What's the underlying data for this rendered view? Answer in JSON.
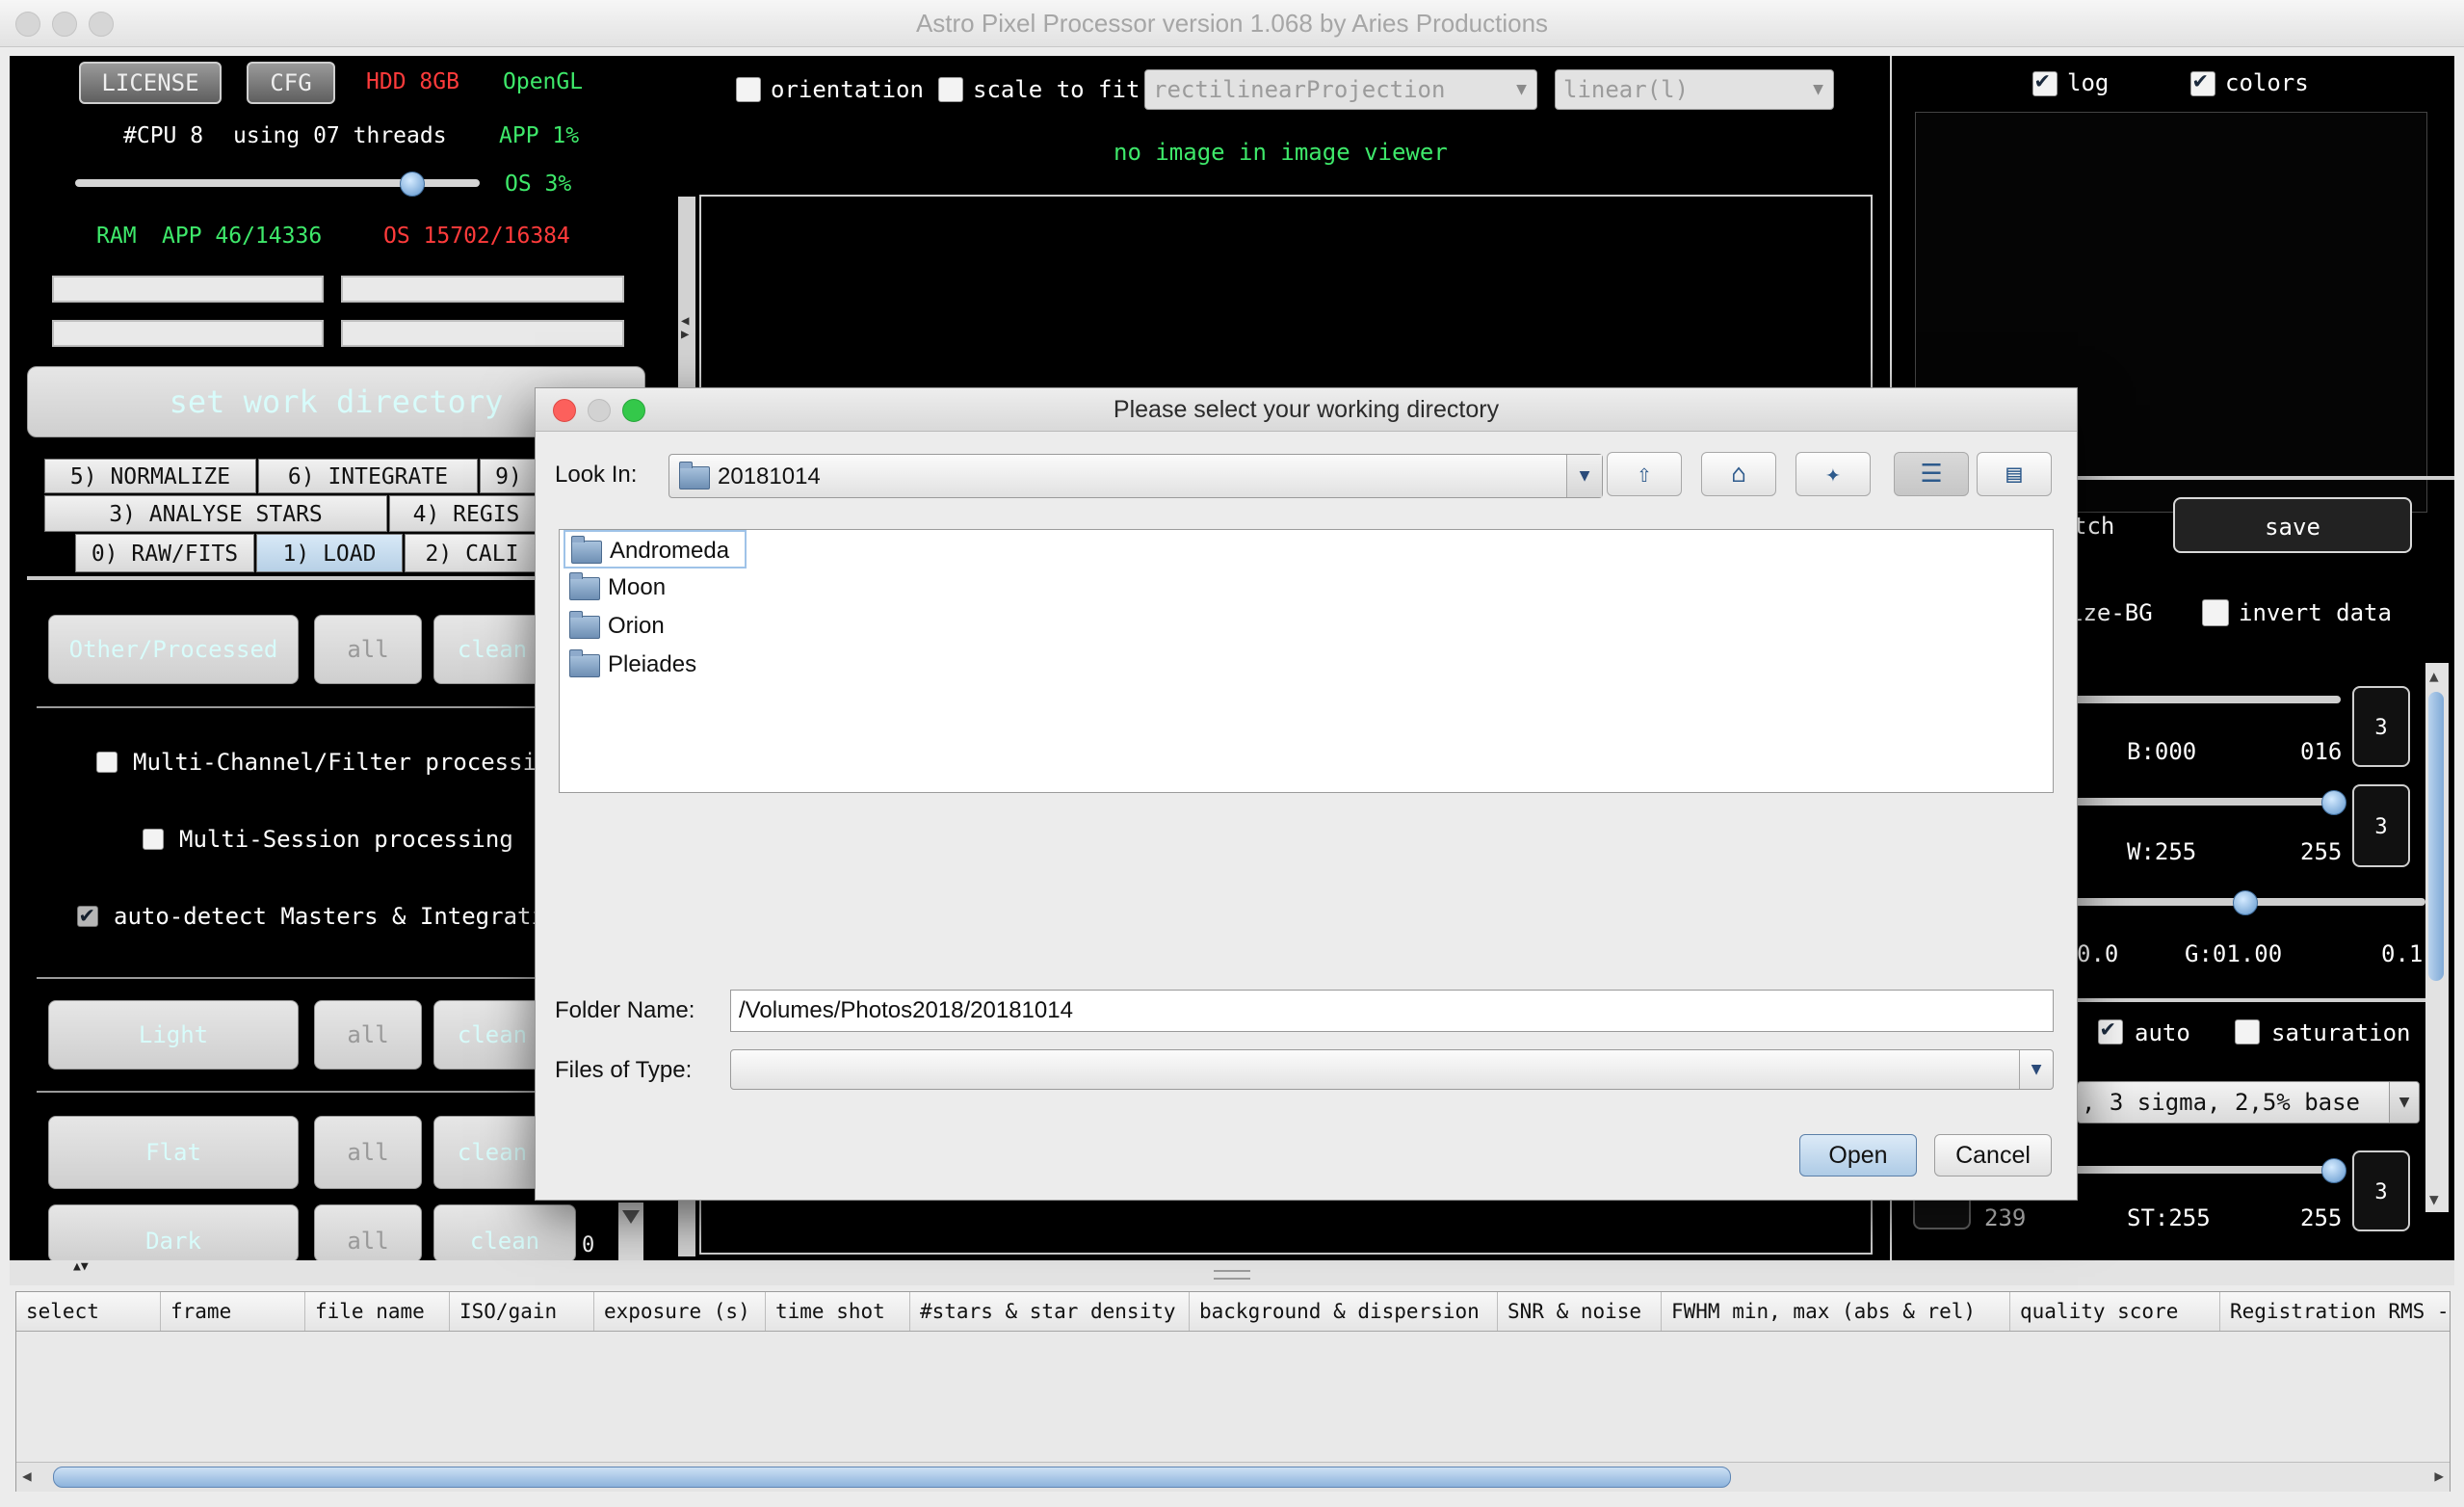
{
  "window": {
    "title": "Astro Pixel Processor version 1.068 by Aries Productions"
  },
  "top_left": {
    "license_label": "LICENSE",
    "cfg_label": "CFG",
    "hdd": "HDD 8GB",
    "opengl": "OpenGL",
    "cpu": "#CPU 8",
    "threads": "using 07 threads",
    "app_cpu": "APP 1%",
    "os_cpu": "OS 3%",
    "threads_slider": 0.83,
    "ram_label": "RAM",
    "ram_app": "APP 46/14336",
    "ram_os": "OS 15702/16384",
    "set_work_dir": "set work directory"
  },
  "tabs": {
    "row1": [
      "5) NORMALIZE",
      "6) INTEGRATE",
      "9)"
    ],
    "row2": [
      "3) ANALYSE STARS",
      "4) REGIS"
    ],
    "row3": [
      "0) RAW/FITS",
      "1) LOAD",
      "2) CALI"
    ]
  },
  "load_panel": {
    "other_processed": "Other/Processed",
    "all": "all",
    "clean": "clean",
    "multi_channel": "Multi-Channel/Filter processin",
    "multi_session": "Multi-Session processing",
    "auto_detect": "auto-detect Masters & Integratio",
    "light": "Light",
    "flat": "Flat",
    "dark": "Dark",
    "dark_count": "0"
  },
  "viewer": {
    "orientation": "orientation",
    "scale_to_fit": "scale to fit",
    "projection": "rectilinearProjection",
    "stretch": "linear(l)",
    "message": "no image in image viewer"
  },
  "right_panel": {
    "log": "log",
    "colors": "colors",
    "batch_partial": "tch",
    "save": "save",
    "neutralize_partial": "ize-BG",
    "invert": "invert data",
    "b_label": "B:000",
    "b_max": "016",
    "w_label": "W:255",
    "w_max": "255",
    "g_min": "0.0",
    "g_label": "G:01.00",
    "g_max": "0.1",
    "auto": "auto",
    "saturation": "saturation",
    "stretch_preset": ", 3 sigma, 2,5% base",
    "st_min": "239",
    "st_label": "ST:255",
    "st_max": "255",
    "spin_values": [
      "3",
      "3",
      "3"
    ]
  },
  "dialog": {
    "title": "Please select your working directory",
    "look_in_label": "Look In:",
    "look_in_value": "20181014",
    "folders": [
      "Andromeda",
      "Moon",
      "Orion",
      "Pleiades"
    ],
    "folder_name_label": "Folder Name:",
    "folder_name_value": "/Volumes/Photos2018/20181014",
    "files_of_type_label": "Files of Type:",
    "files_of_type_value": "",
    "open": "Open",
    "cancel": "Cancel",
    "toolbar_icons": [
      "up-folder-icon",
      "home-icon",
      "new-folder-icon",
      "list-view-icon",
      "details-view-icon"
    ]
  },
  "table": {
    "columns": [
      "select",
      "frame",
      "file name",
      "ISO/gain",
      "exposure (s)",
      "time shot",
      "#stars & star density",
      "background & dispersion",
      "SNR & noise",
      "FWHM min, max (abs & rel)",
      "quality score",
      "Registration RMS - #"
    ]
  }
}
